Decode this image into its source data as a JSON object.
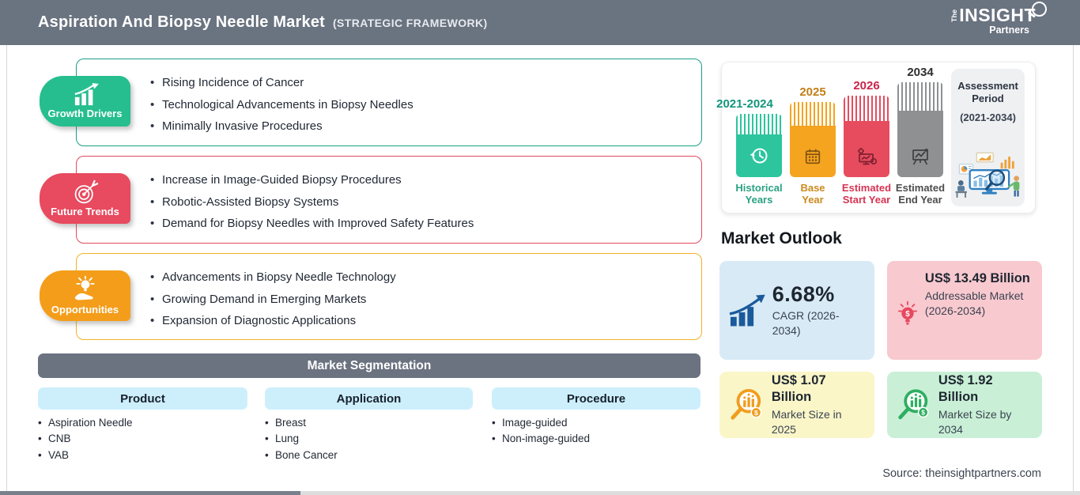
{
  "header": {
    "title": "Aspiration And Biopsy Needle Market",
    "subtitle": "(STRATEGIC FRAMEWORK)",
    "logo": {
      "the": "The",
      "insight": "INSIGHT",
      "partners": "Partners"
    }
  },
  "sections": [
    {
      "label": "Growth Drivers",
      "icon": "growth-chart-icon",
      "accent_color": "#26be8e",
      "border_color": "#1a9f85",
      "items": [
        "Rising Incidence of Cancer",
        "Technological Advancements in Biopsy Needles",
        "Minimally Invasive Procedures"
      ]
    },
    {
      "label": "Future Trends",
      "icon": "target-dart-icon",
      "accent_color": "#e84a5f",
      "border_color": "#e04a5c",
      "items": [
        "Increase in Image-Guided Biopsy Procedures",
        "Robotic-Assisted Biopsy Systems",
        "Demand for Biopsy Needles with Improved Safety Features"
      ]
    },
    {
      "label": "Opportunities",
      "icon": "bulb-hand-icon",
      "accent_color": "#f49d1a",
      "border_color": "#f3b229",
      "items": [
        "Advancements in Biopsy Needle Technology",
        "Growing Demand in Emerging Markets",
        "Expansion of Diagnostic Applications"
      ]
    }
  ],
  "segmentation": {
    "title": "Market Segmentation",
    "columns": [
      {
        "header": "Product",
        "items": [
          "Aspiration Needle",
          "CNB",
          "VAB"
        ]
      },
      {
        "header": "Application",
        "items": [
          "Breast",
          "Lung",
          "Bone Cancer"
        ]
      },
      {
        "header": "Procedure",
        "items": [
          "Image-guided",
          "Non-image-guided"
        ]
      }
    ]
  },
  "timeline": {
    "bars": [
      {
        "year": "2021-2024",
        "label1": "Historical",
        "label2": "Years",
        "color": "#2cc59e",
        "icon": "history-clock-icon"
      },
      {
        "year": "2025",
        "label1": "Base",
        "label2": "Year",
        "color": "#f5a41f",
        "icon": "calendar-icon"
      },
      {
        "year": "2026",
        "label1": "Estimated",
        "label2": "Start Year",
        "color": "#e74b5e",
        "icon": "monitor-chart-icon"
      },
      {
        "year": "2034",
        "label1": "Estimated",
        "label2": "End Year",
        "color": "#8e9091",
        "icon": "presentation-chart-icon"
      }
    ],
    "assessment": {
      "title1": "Assessment",
      "title2": "Period",
      "period": "(2021-2034)",
      "icon": "analysts-illustration"
    }
  },
  "outlook": {
    "title": "Market Outlook",
    "cards": [
      {
        "value": "6.68%",
        "label": "CAGR (2026-2034)",
        "bg": "#d8eaf6",
        "icon": "cagr-growth-icon",
        "icon_color": "#1b5a9b"
      },
      {
        "value": "US$ 13.49 Billion",
        "label": "Addressable Market (2026-2034)",
        "bg": "#f8c9cf",
        "icon": "bulb-dollar-icon",
        "icon_color": "#e8495f"
      },
      {
        "value": "US$ 1.07 Billion",
        "label": "Market Size in 2025",
        "bg": "#faf6c8",
        "icon": "market-magnifier-icon",
        "icon_color": "#f09d1e"
      },
      {
        "value": "US$ 1.92 Billion",
        "label": "Market Size by 2034",
        "bg": "#c9f0d6",
        "icon": "market-magnifier-icon",
        "icon_color": "#2fae62"
      }
    ]
  },
  "source": {
    "text": "Source: theinsightpartners.com"
  },
  "scrollbar": {
    "thumb_position": "left"
  }
}
